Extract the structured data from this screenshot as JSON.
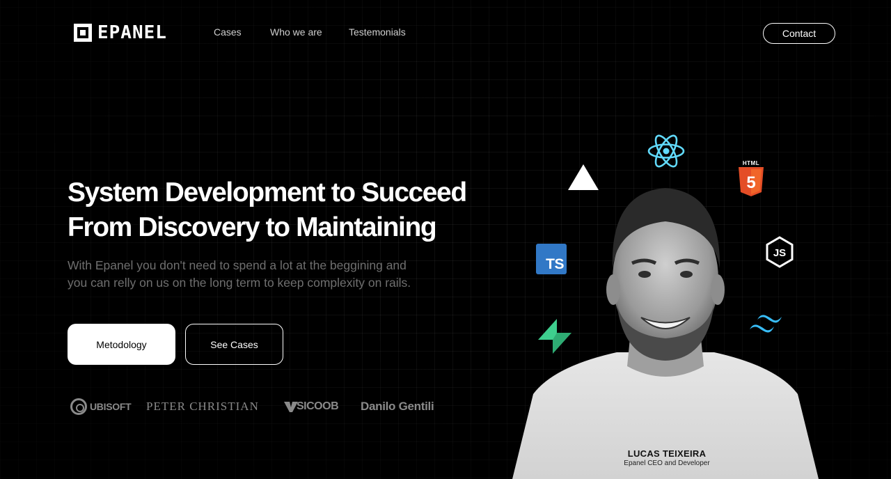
{
  "brand": {
    "name": "EPANEL"
  },
  "nav": {
    "links": [
      "Cases",
      "Who we are",
      "Testemonials"
    ],
    "contact_label": "Contact"
  },
  "hero": {
    "title_line1": "System Development to Succeed",
    "title_line2": "From Discovery to Maintaining",
    "subtitle_line1": "With Epanel you don't need to spend a lot at the beggining and",
    "subtitle_line2": "you can relly on us on the long term to keep complexity on rails.",
    "primary_button": "Metodology",
    "secondary_button": "See Cases"
  },
  "clients": [
    "UBISOFT",
    "PETER CHRISTIAN",
    "SICOOB",
    "Danilo Gentili"
  ],
  "person": {
    "name": "LUCAS TEIXEIRA",
    "role": "Epanel CEO and Developer"
  },
  "tech_icons": [
    {
      "icon": "vercel-icon",
      "color": "#ffffff"
    },
    {
      "icon": "react-icon",
      "color": "#61dafb"
    },
    {
      "icon": "html5-icon",
      "color": "#e44d26",
      "label": "HTML",
      "digit": "5"
    },
    {
      "icon": "typescript-icon",
      "color": "#3178c6",
      "label": "TS"
    },
    {
      "icon": "nodejs-icon",
      "color": "#ffffff",
      "label": "JS"
    },
    {
      "icon": "supabase-icon",
      "color": "#3ecf8e"
    },
    {
      "icon": "tailwind-icon",
      "color": "#38bdf8"
    }
  ],
  "colors": {
    "background": "#000000",
    "text": "#ffffff",
    "muted": "#6f6f6f"
  }
}
